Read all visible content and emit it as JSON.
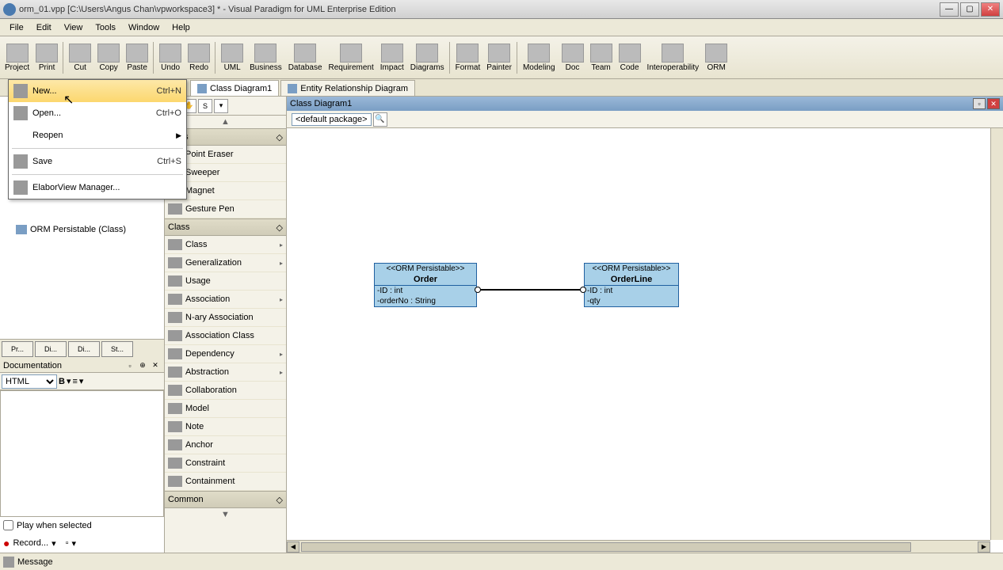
{
  "titlebar": {
    "title": "orm_01.vpp [C:\\Users\\Angus Chan\\vpworkspace3] * - Visual Paradigm for UML Enterprise Edition"
  },
  "menubar": [
    "File",
    "Edit",
    "View",
    "Tools",
    "Window",
    "Help"
  ],
  "toolbar": [
    {
      "label": "Project"
    },
    {
      "label": "Print"
    },
    {
      "label": "Cut"
    },
    {
      "label": "Copy"
    },
    {
      "label": "Paste"
    },
    {
      "label": "Undo"
    },
    {
      "label": "Redo"
    },
    {
      "label": "UML"
    },
    {
      "label": "Business"
    },
    {
      "label": "Database"
    },
    {
      "label": "Requirement"
    },
    {
      "label": "Impact"
    },
    {
      "label": "Diagrams"
    },
    {
      "label": "Format"
    },
    {
      "label": "Painter"
    },
    {
      "label": "Modeling"
    },
    {
      "label": "Doc"
    },
    {
      "label": "Team"
    },
    {
      "label": "Code"
    },
    {
      "label": "Interoperability"
    },
    {
      "label": "ORM"
    }
  ],
  "project_menu": [
    {
      "label": "New...",
      "shortcut": "Ctrl+N",
      "hover": true
    },
    {
      "label": "Open...",
      "shortcut": "Ctrl+O"
    },
    {
      "label": "Reopen",
      "submenu": true
    },
    {
      "sep": true
    },
    {
      "label": "Save",
      "shortcut": "Ctrl+S"
    },
    {
      "sep": true
    },
    {
      "label": "ElaborView Manager..."
    }
  ],
  "tabs": [
    {
      "label": "Class Diagram1",
      "active": true
    },
    {
      "label": "Entity Relationship Diagram"
    }
  ],
  "diagram_title": "Class Diagram1",
  "package_crumb": "<default package>",
  "tree": {
    "visible_item": "ORM Persistable (Class)"
  },
  "nav_tabs": [
    "Pr...",
    "Di...",
    "Di...",
    "St..."
  ],
  "documentation": {
    "title": "Documentation",
    "format": "HTML",
    "play_label": "Play when selected",
    "record_label": "Record..."
  },
  "palette": {
    "tools_header": "Tools",
    "tools": [
      "Point Eraser",
      "Sweeper",
      "Magnet",
      "Gesture Pen"
    ],
    "class_header": "Class",
    "class_items": [
      {
        "label": "Class",
        "exp": true
      },
      {
        "label": "Generalization",
        "exp": true
      },
      {
        "label": "Usage"
      },
      {
        "label": "Association",
        "exp": true
      },
      {
        "label": "N-ary Association"
      },
      {
        "label": "Association Class"
      },
      {
        "label": "Dependency",
        "exp": true
      },
      {
        "label": "Abstraction",
        "exp": true
      },
      {
        "label": "Collaboration"
      },
      {
        "label": "Model"
      },
      {
        "label": "Note"
      },
      {
        "label": "Anchor"
      },
      {
        "label": "Constraint"
      },
      {
        "label": "Containment"
      }
    ],
    "common_header": "Common"
  },
  "uml": {
    "order": {
      "stereotype": "<<ORM Persistable>>",
      "name": "Order",
      "attrs": [
        "-ID : int",
        "-orderNo : String"
      ]
    },
    "orderline": {
      "stereotype": "<<ORM Persistable>>",
      "name": "OrderLine",
      "attrs": [
        "-ID : int",
        "-qty"
      ]
    }
  },
  "statusbar": {
    "message": "Message"
  }
}
